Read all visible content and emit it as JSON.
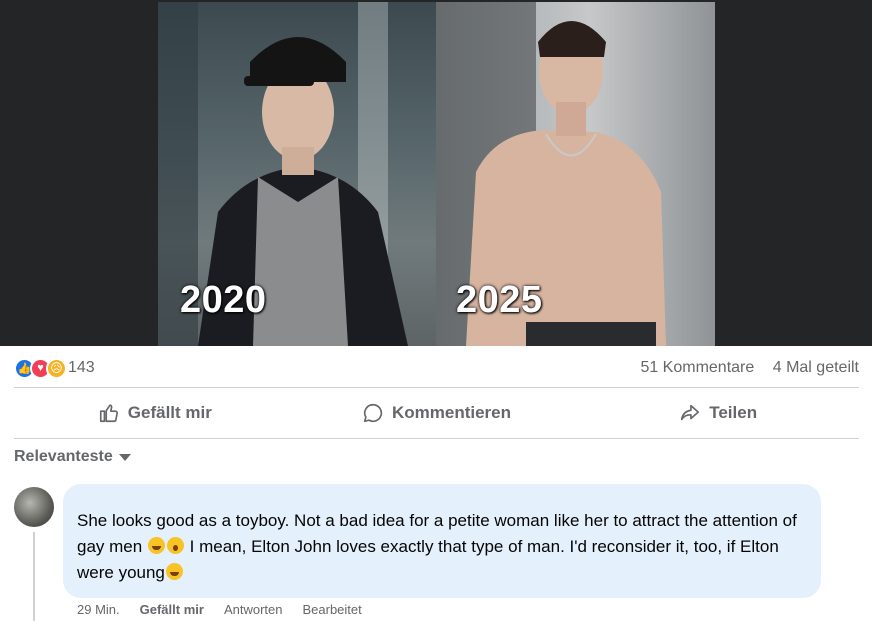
{
  "post": {
    "image": {
      "left_year": "2020",
      "right_year": "2025"
    }
  },
  "stats": {
    "reaction_icons": [
      "like-icon",
      "love-icon",
      "sad-icon"
    ],
    "reaction_count": "143",
    "comments": "51 Kommentare",
    "shares": "4 Mal geteilt"
  },
  "actions": {
    "like": "Gefällt mir",
    "comment": "Kommentieren",
    "share": "Teilen"
  },
  "sort": {
    "label": "Relevanteste"
  },
  "comment": {
    "author": "",
    "text_part1": "She looks good as a toyboy. Not a bad idea for a petite woman like her to attract the attention of gay men",
    "text_part2": " I mean, Elton John loves exactly that type of man. I'd reconsider it, too, if Elton were young",
    "time": "29 Min.",
    "like_label": "Gefällt mir",
    "reply_label": "Antworten",
    "edited_label": "Bearbeitet"
  },
  "colors": {
    "accent": "#1b74e4",
    "bubble": "#e4f0fb",
    "muted": "#65676b"
  }
}
